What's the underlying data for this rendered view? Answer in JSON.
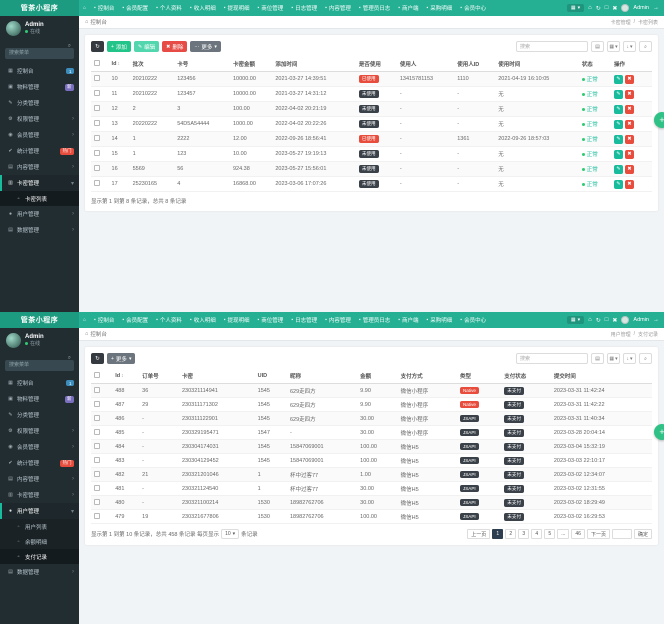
{
  "icons": {
    "home": "⌂",
    "search": "⌕",
    "refresh": "↻",
    "caret": "▾",
    "chevron": "›",
    "chevron_open": "▾",
    "sort": "↕",
    "edit": "✎",
    "delete": "✖",
    "fullscreen": "□",
    "close": "✖",
    "module": "▦",
    "rows": "▤",
    "columns": "▦",
    "download": "↓",
    "slash": "/"
  },
  "badge_colors": {
    "已使用": "#e74c3c",
    "未使用": "#3a4149",
    "Native": "#e74c3c",
    "JSAPI": "#3a4149",
    "未支付": "#3a4149"
  },
  "status_ok": "正常",
  "screens": [
    {
      "logo": "管茶小程序",
      "nav": [
        "控制台",
        "会员配置",
        "个人资料",
        "收入明细",
        "提现明细",
        "商位管理",
        "日志管理",
        "内容管理",
        "管理员日志",
        "商户端",
        "采购明细",
        "会员中心"
      ],
      "nav_right": {
        "admin": "Admin",
        "icon_names": [
          "home-icon",
          "refresh-icon",
          "fullscreen-icon",
          "close-icon"
        ],
        "icon_glyphs": [
          "⌂",
          "↻",
          "□",
          "✖"
        ]
      },
      "user": {
        "name": "Admin",
        "status": "在线"
      },
      "search_placeholder": "搜索菜单",
      "menu": [
        {
          "label": "控制台",
          "icon": "▦",
          "badge": "1",
          "badge_color": "#3c8dbc"
        },
        {
          "label": "物料管理",
          "icon": "▣",
          "badge": "新",
          "badge_color": "#7a6fbe"
        },
        {
          "label": "分类管理",
          "icon": "✎"
        },
        {
          "label": "权限管理",
          "icon": "⚙",
          "chevron": true
        },
        {
          "label": "会员管理",
          "icon": "◉",
          "chevron": true
        },
        {
          "label": "统计管理",
          "icon": "✔",
          "badge": "热门",
          "badge_color": "#e74c3c"
        },
        {
          "label": "内容管理",
          "icon": "▤",
          "chevron": true
        },
        {
          "label": "卡密管理",
          "icon": "▥",
          "open": true,
          "sub": [
            {
              "label": "卡密列表",
              "active": true
            }
          ]
        },
        {
          "label": "用户管理",
          "icon": "●",
          "chevron": true
        },
        {
          "label": "数据管理",
          "icon": "▤",
          "chevron": true
        }
      ],
      "breadcrumb": {
        "home": "控制台",
        "trail": [
          "卡密管理",
          "卡密列表"
        ]
      },
      "toolbar": {
        "buttons": [
          {
            "label": "添加",
            "icon": "+",
            "bg": "#23c48a"
          },
          {
            "label": "编辑",
            "icon": "✎",
            "bg": "#52d6ad"
          },
          {
            "label": "删除",
            "icon": "✖",
            "bg": "#e64c45"
          },
          {
            "label": "更多",
            "icon": "⋯",
            "bg": "#6c757d",
            "caret": true
          }
        ],
        "search_placeholder": "搜索",
        "tools": [
          {
            "name": "toggle-rows-icon",
            "glyph": "▤"
          },
          {
            "name": "columns-icon",
            "glyph": "▦",
            "caret": true
          },
          {
            "name": "export-icon",
            "glyph": "↓",
            "caret": true
          },
          {
            "name": "search-settings-icon",
            "glyph": "⌕"
          }
        ]
      },
      "table": {
        "columns": [
          {
            "label": "",
            "type": "checkbox"
          },
          {
            "label": "Id",
            "sort": true
          },
          {
            "label": "批次"
          },
          {
            "label": "卡号"
          },
          {
            "label": "卡密金额"
          },
          {
            "label": "添加时间"
          },
          {
            "label": "是否使用",
            "type": "badge"
          },
          {
            "label": "使用人"
          },
          {
            "label": "使用人ID"
          },
          {
            "label": "使用时间"
          },
          {
            "label": "状态",
            "type": "status"
          },
          {
            "label": "操作",
            "type": "ops"
          }
        ],
        "rows": [
          [
            "10",
            "20210222",
            "123456",
            "10000.00",
            "2021-03-27 14:39:51",
            "已使用",
            "13415781153",
            "1110",
            "2021-04-19 16:10:05",
            "正常",
            ""
          ],
          [
            "11",
            "20210222",
            "123457",
            "10000.00",
            "2021-03-27 14:31:12",
            "未使用",
            "-",
            "-",
            "无",
            "正常",
            ""
          ],
          [
            "12",
            "2",
            "3",
            "100.00",
            "2022-04-02 20:21:19",
            "未使用",
            "-",
            "-",
            "无",
            "正常",
            ""
          ],
          [
            "13",
            "20220222",
            "54D5A54444",
            "1000.00",
            "2022-04-02 20:22:26",
            "未使用",
            "-",
            "-",
            "无",
            "正常",
            ""
          ],
          [
            "14",
            "1",
            "2222",
            "12.00",
            "2022-09-26 18:56:41",
            "已使用",
            "-",
            "1361",
            "2022-09-26 18:57:03",
            "正常",
            ""
          ],
          [
            "15",
            "1",
            "123",
            "10.00",
            "2023-05-27 19:19:13",
            "未使用",
            "-",
            "-",
            "无",
            "正常",
            ""
          ],
          [
            "16",
            "5569",
            "56",
            "924.38",
            "2023-05-27 15:56:01",
            "未使用",
            "-",
            "-",
            "无",
            "正常",
            ""
          ],
          [
            "17",
            "25230165",
            "4",
            "16868.00",
            "2023-03-06 17:07:26",
            "未使用",
            "-",
            "-",
            "无",
            "正常",
            ""
          ]
        ]
      },
      "footer": {
        "summary": "显示第 1 到第 8 条记录，总共 8 条记录"
      }
    },
    {
      "logo": "管茶小程序",
      "nav": [
        "控制台",
        "会员配置",
        "个人资料",
        "收入明细",
        "提现明细",
        "商位管理",
        "日志管理",
        "内容管理",
        "管理员日志",
        "商户端",
        "采购明细",
        "会员中心"
      ],
      "nav_right": {
        "admin": "Admin",
        "icon_names": [
          "home-icon",
          "refresh-icon",
          "fullscreen-icon",
          "close-icon"
        ],
        "icon_glyphs": [
          "⌂",
          "↻",
          "□",
          "✖"
        ]
      },
      "user": {
        "name": "Admin",
        "status": "在线"
      },
      "search_placeholder": "搜索菜单",
      "menu": [
        {
          "label": "控制台",
          "icon": "▦",
          "badge": "1",
          "badge_color": "#3c8dbc"
        },
        {
          "label": "物料管理",
          "icon": "▣",
          "badge": "新",
          "badge_color": "#7a6fbe"
        },
        {
          "label": "分类管理",
          "icon": "✎"
        },
        {
          "label": "权限管理",
          "icon": "⚙",
          "chevron": true
        },
        {
          "label": "会员管理",
          "icon": "◉",
          "chevron": true
        },
        {
          "label": "统计管理",
          "icon": "✔",
          "badge": "热门",
          "badge_color": "#e74c3c"
        },
        {
          "label": "内容管理",
          "icon": "▤",
          "chevron": true
        },
        {
          "label": "卡密管理",
          "icon": "▥",
          "chevron": true
        },
        {
          "label": "用户管理",
          "icon": "●",
          "open": true,
          "sub": [
            {
              "label": "用户列表"
            },
            {
              "label": "余额明细"
            },
            {
              "label": "支付记录",
              "active": true
            }
          ]
        },
        {
          "label": "数据管理",
          "icon": "▤",
          "chevron": true
        }
      ],
      "breadcrumb": {
        "home": "控制台",
        "trail": [
          "用户管理",
          "支付记录"
        ]
      },
      "toolbar": {
        "buttons": [
          {
            "label": "更多",
            "icon": "+",
            "bg": "#6c757d",
            "caret": true
          }
        ],
        "search_placeholder": "搜索",
        "tools": [
          {
            "name": "toggle-rows-icon",
            "glyph": "▤"
          },
          {
            "name": "columns-icon",
            "glyph": "▦",
            "caret": true
          },
          {
            "name": "export-icon",
            "glyph": "↓",
            "caret": true
          },
          {
            "name": "search-settings-icon",
            "glyph": "⌕"
          }
        ]
      },
      "table": {
        "columns": [
          {
            "label": "",
            "type": "checkbox"
          },
          {
            "label": "Id",
            "sort": true
          },
          {
            "label": "订单号"
          },
          {
            "label": "卡密"
          },
          {
            "label": "UID"
          },
          {
            "label": "昵称"
          },
          {
            "label": "金额"
          },
          {
            "label": "支付方式"
          },
          {
            "label": "类型",
            "type": "badge"
          },
          {
            "label": "支付状态",
            "type": "badge"
          },
          {
            "label": "提交时间"
          }
        ],
        "rows": [
          [
            "488",
            "36",
            "230321114941",
            "1545",
            "629走四方",
            "9.90",
            "微信小程序",
            "Native",
            "未支付",
            "2023-03-31 11:42:24"
          ],
          [
            "487",
            "29",
            "230311171302",
            "1545",
            "629走四方",
            "9.90",
            "微信小程序",
            "Native",
            "未支付",
            "2023-03-31 11:42:22"
          ],
          [
            "486",
            "-",
            "230311122901",
            "1545",
            "629走四方",
            "30.00",
            "微信小程序",
            "JSAPI",
            "未支付",
            "2023-03-31 11:40:34"
          ],
          [
            "485",
            "-",
            "230329195471",
            "1547",
            "-",
            "30.00",
            "微信小程序",
            "JSAPI",
            "未支付",
            "2023-03-28 20:04:14"
          ],
          [
            "484",
            "-",
            "230304174031",
            "1545",
            "15847069001",
            "100.00",
            "微信H5",
            "JSAPI",
            "未支付",
            "2023-03-04 15:32:19"
          ],
          [
            "483",
            "-",
            "230304129452",
            "1545",
            "15847069001",
            "100.00",
            "微信H5",
            "JSAPI",
            "未支付",
            "2023-03-03 22:10:17"
          ],
          [
            "482",
            "21",
            "230321201046",
            "1",
            "杯中过客77",
            "1.00",
            "微信H5",
            "JSAPI",
            "未支付",
            "2023-03-02 12:34:07"
          ],
          [
            "481",
            "-",
            "230321124540",
            "1",
            "杯中过客77",
            "30.00",
            "微信H5",
            "JSAPI",
            "未支付",
            "2023-03-02 12:31:55"
          ],
          [
            "480",
            "-",
            "230321100214",
            "1530",
            "18982762706",
            "30.00",
            "微信H5",
            "JSAPI",
            "未支付",
            "2023-03-02 18:29:49"
          ],
          [
            "479",
            "19",
            "230321677806",
            "1530",
            "18982762706",
            "100.00",
            "微信H5",
            "JSAPI",
            "未支付",
            "2023-03-02 16:29:53"
          ]
        ]
      },
      "footer": {
        "summary_prefix": "显示第 1 到第 10 条记录，总共 458 条记录 每页显示",
        "per_page": "10",
        "summary_suffix": "条记录",
        "pagination": {
          "prev": "上一页",
          "pages": [
            "1",
            "2",
            "3",
            "4",
            "5",
            "...",
            "46"
          ],
          "active": "1",
          "next": "下一页",
          "confirm": "确定"
        }
      }
    }
  ]
}
